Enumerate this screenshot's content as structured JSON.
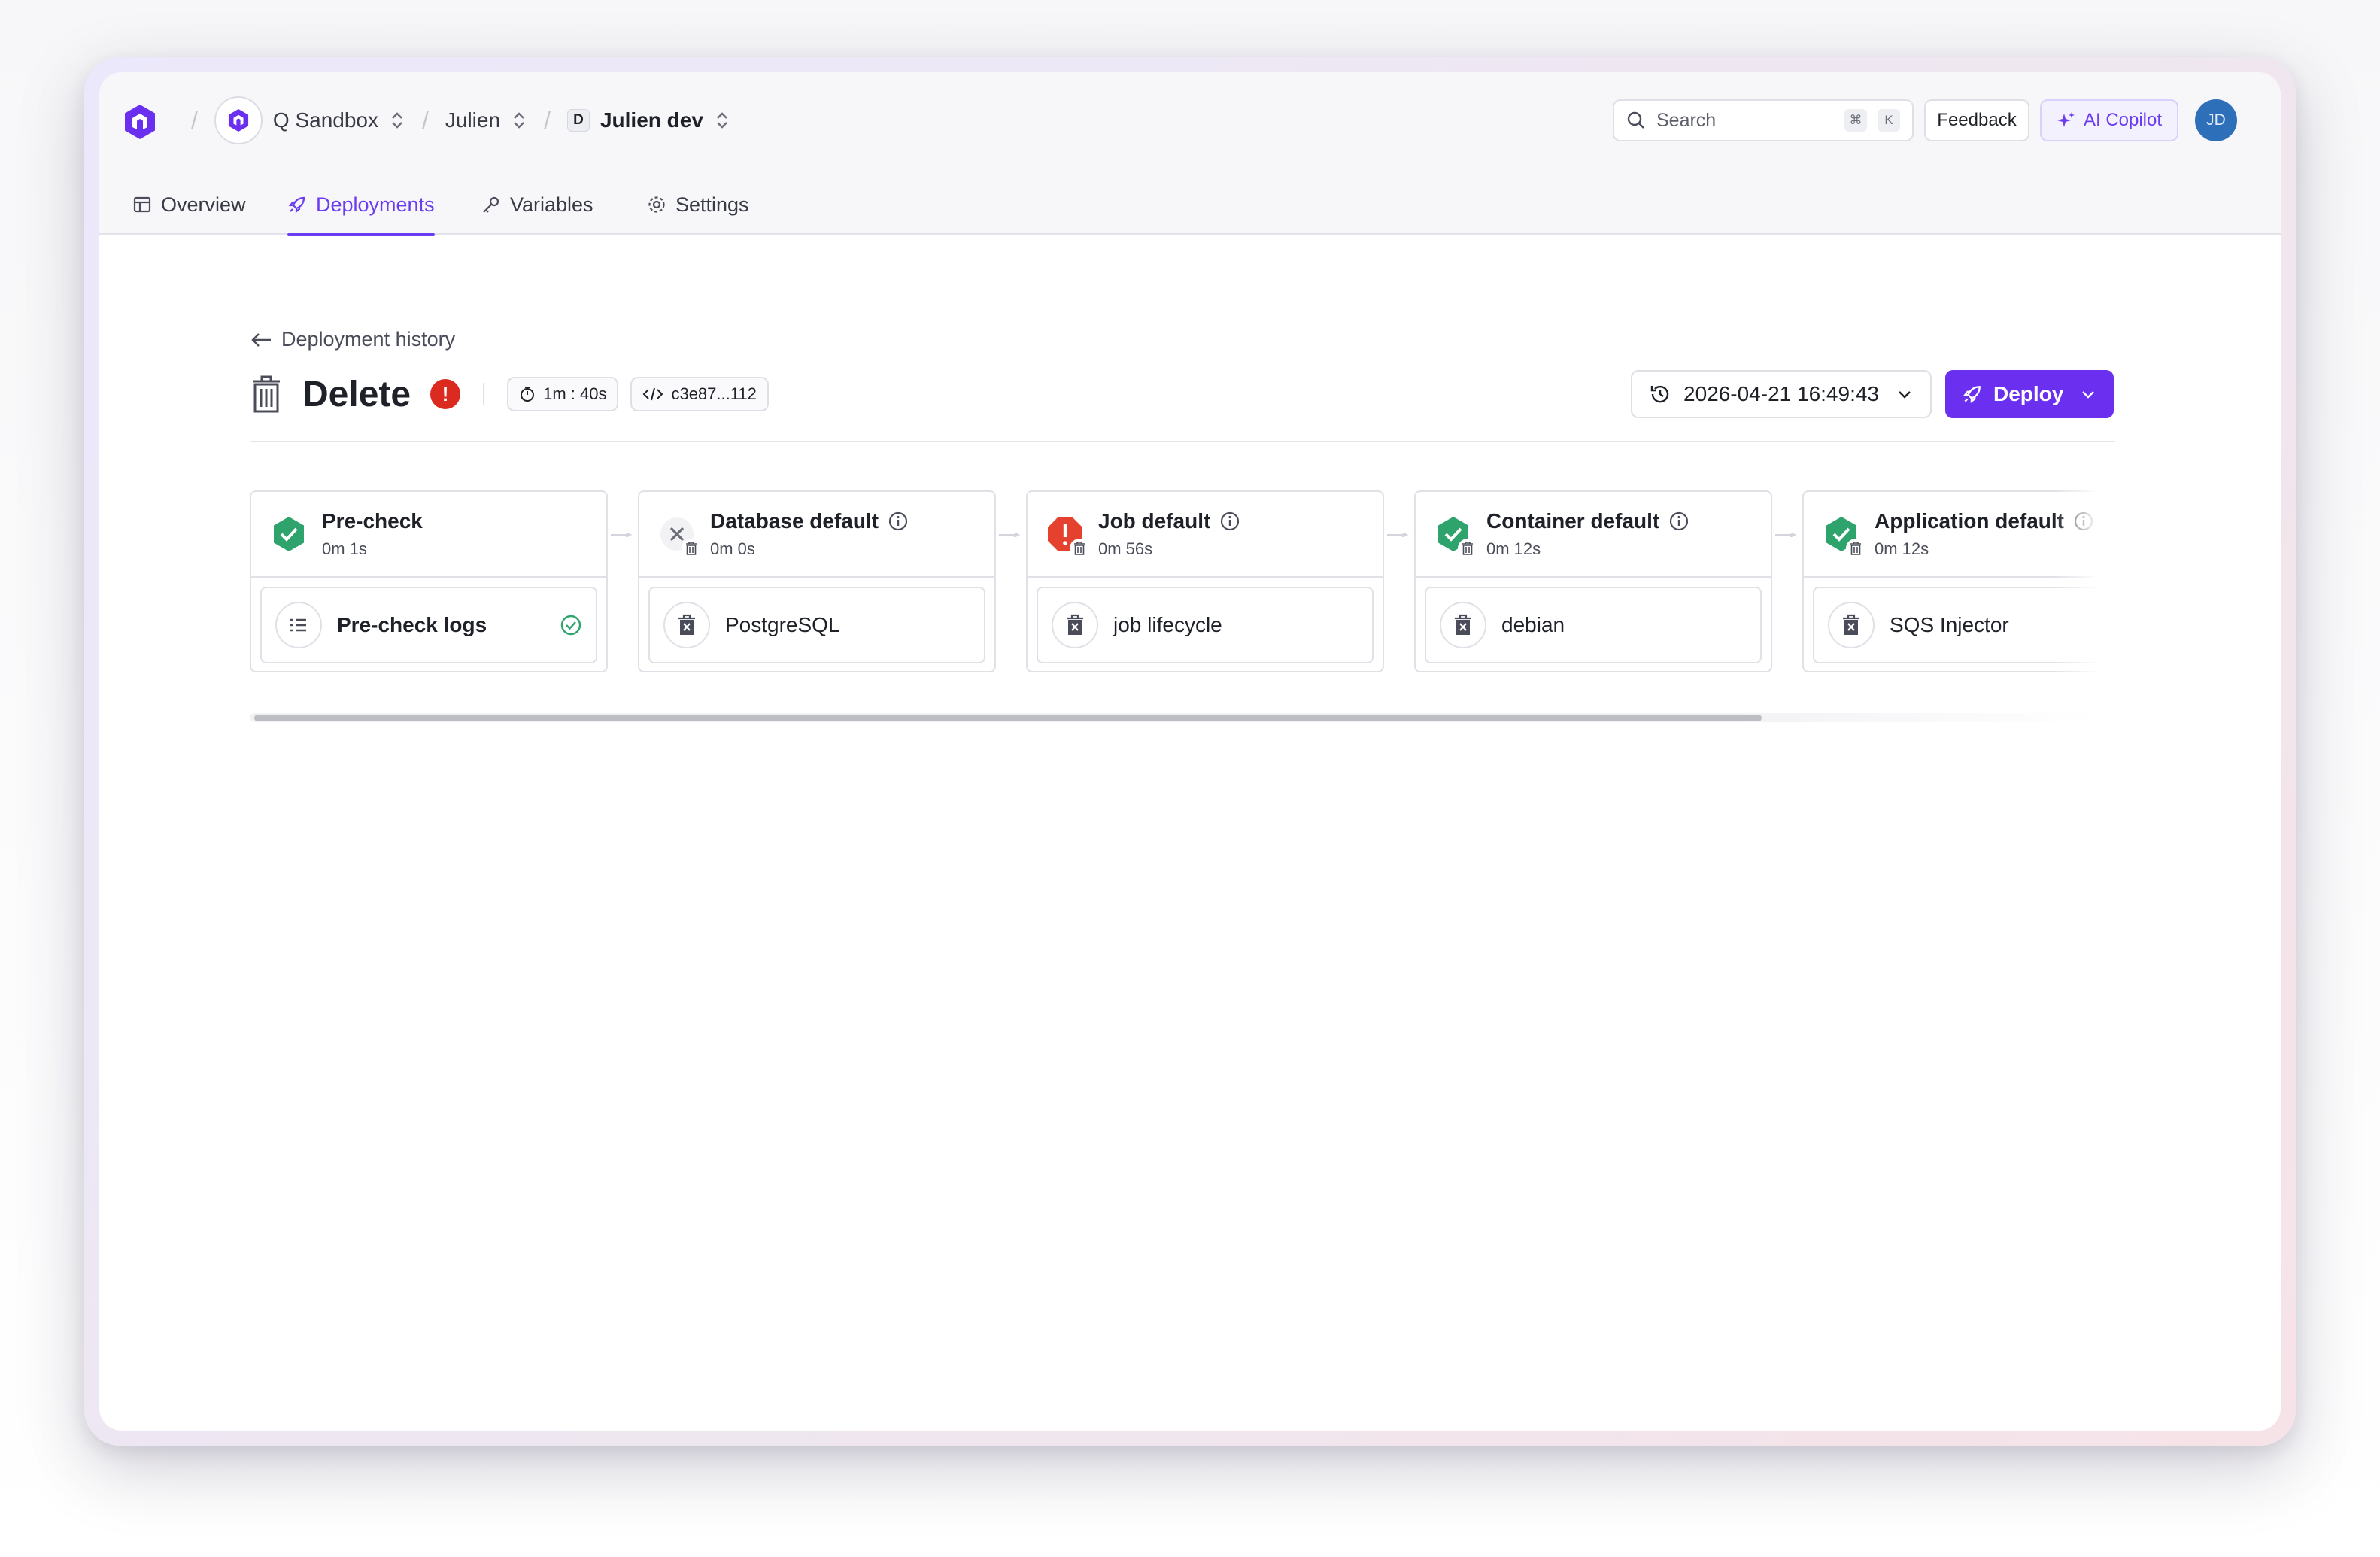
{
  "header": {
    "org": "Q Sandbox",
    "project": "Julien",
    "env_badge": "D",
    "env": "Julien dev",
    "search_placeholder": "Search",
    "search_kbd1": "⌘",
    "search_kbd2": "K",
    "feedback": "Feedback",
    "ai_copilot": "AI Copilot",
    "avatar": "JD"
  },
  "tabs": [
    {
      "label": "Overview",
      "icon": "layout-icon"
    },
    {
      "label": "Deployments",
      "icon": "rocket-icon",
      "active": true
    },
    {
      "label": "Variables",
      "icon": "key-icon"
    },
    {
      "label": "Settings",
      "icon": "gear-icon"
    }
  ],
  "page": {
    "back_label": "Deployment history",
    "title": "Delete",
    "error_badge": "!",
    "duration": "1m : 40s",
    "commit": "c3e87...112",
    "date": "2026-04-21 16:49:43",
    "deploy": "Deploy"
  },
  "stages": [
    {
      "name": "Pre-check",
      "duration": "0m 1s",
      "status": "success",
      "item": "Pre-check logs",
      "item_icon": "list-icon"
    },
    {
      "name": "Database default",
      "duration": "0m 0s",
      "status": "skipped",
      "item": "PostgreSQL",
      "item_icon": "trash-icon"
    },
    {
      "name": "Job default",
      "duration": "0m 56s",
      "status": "error",
      "item": "job lifecycle",
      "item_icon": "trash-icon"
    },
    {
      "name": "Container default",
      "duration": "0m 12s",
      "status": "success",
      "item": "debian",
      "item_icon": "trash-icon"
    },
    {
      "name": "Application default",
      "duration": "0m 12s",
      "status": "success",
      "item": "SQS Injector",
      "item_icon": "trash-icon"
    }
  ],
  "colors": {
    "accent": "#6b2ff0",
    "success": "#2ea36b",
    "error": "#e4412f"
  }
}
